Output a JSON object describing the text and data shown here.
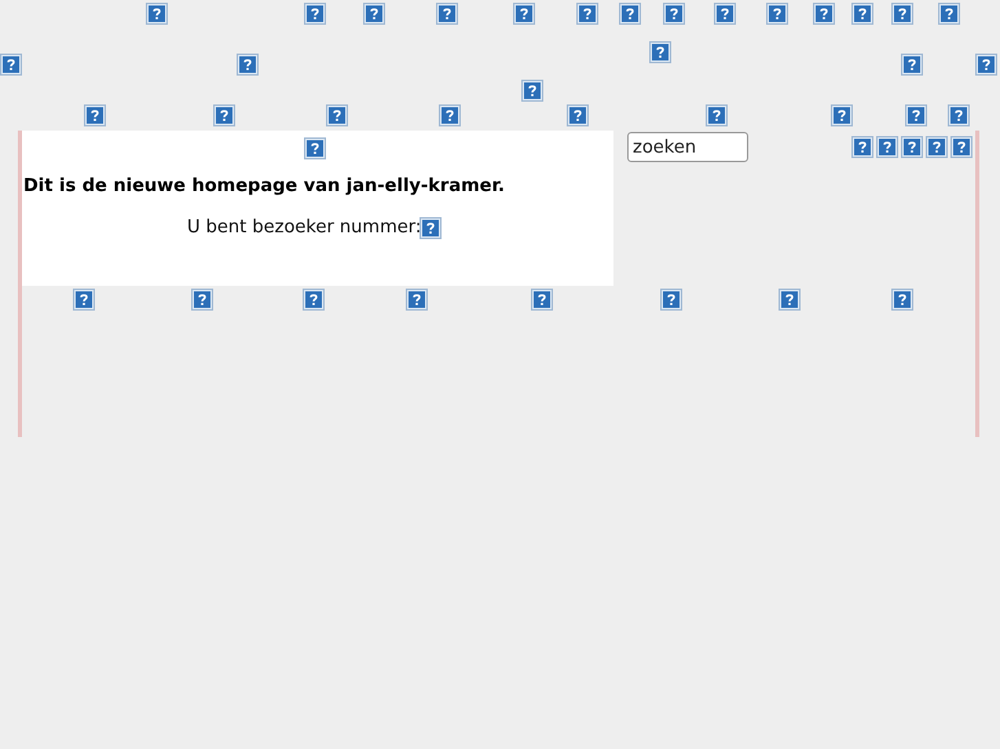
{
  "search": {
    "value": "zoeken"
  },
  "heading": "Dit is de nieuwe homepage van jan-elly-kramer.",
  "visitor_label": "U bent bezoeker nummer:"
}
